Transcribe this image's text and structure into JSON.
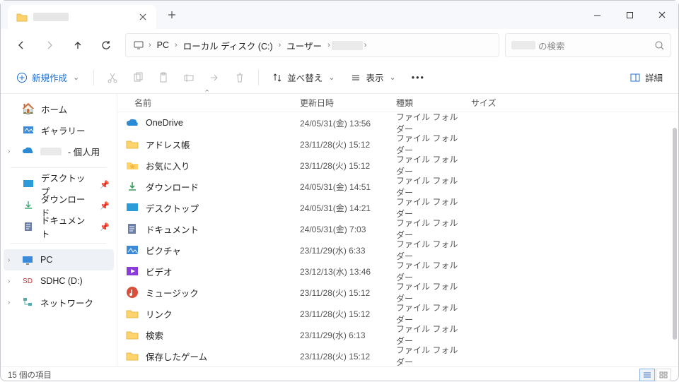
{
  "titlebar": {
    "tab_title": "████"
  },
  "breadcrumb": {
    "pc": "PC",
    "drive": "ローカル ディスク (C:)",
    "users": "ユーザー",
    "user": "████"
  },
  "search": {
    "suffix": "の検索"
  },
  "toolbar": {
    "new": "新規作成",
    "sort": "並べ替え",
    "view": "表示",
    "details": "詳細"
  },
  "sidebar": {
    "home": "ホーム",
    "gallery": "ギャラリー",
    "personal_suffix": " - 個人用",
    "desktop": "デスクトップ",
    "downloads": "ダウンロード",
    "documents": "ドキュメント",
    "pc": "PC",
    "sdhc": "SDHC (D:)",
    "network": "ネットワーク"
  },
  "columns": {
    "name": "名前",
    "date": "更新日時",
    "type": "種類",
    "size": "サイズ"
  },
  "type_folder": "ファイル フォルダー",
  "files": [
    {
      "icon": "onedrive",
      "name": "OneDrive",
      "date": "24/05/31(金) 13:56"
    },
    {
      "icon": "folder",
      "name": "アドレス帳",
      "date": "23/11/28(火) 15:12"
    },
    {
      "icon": "fav",
      "name": "お気に入り",
      "date": "23/11/28(火) 15:12"
    },
    {
      "icon": "download",
      "name": "ダウンロード",
      "date": "24/05/31(金) 14:51"
    },
    {
      "icon": "desktop",
      "name": "デスクトップ",
      "date": "24/05/31(金) 14:21"
    },
    {
      "icon": "document",
      "name": "ドキュメント",
      "date": "24/05/31(金) 7:03"
    },
    {
      "icon": "picture",
      "name": "ピクチャ",
      "date": "23/11/29(水) 6:33"
    },
    {
      "icon": "video",
      "name": "ビデオ",
      "date": "23/12/13(水) 13:46"
    },
    {
      "icon": "music",
      "name": "ミュージック",
      "date": "23/11/28(火) 15:12"
    },
    {
      "icon": "folder",
      "name": "リンク",
      "date": "23/11/28(火) 15:12"
    },
    {
      "icon": "folder",
      "name": "検索",
      "date": "23/11/29(水) 6:13"
    },
    {
      "icon": "folder",
      "name": "保存したゲーム",
      "date": "23/11/28(火) 15:12"
    }
  ],
  "status": {
    "count": "15 個の項目"
  }
}
